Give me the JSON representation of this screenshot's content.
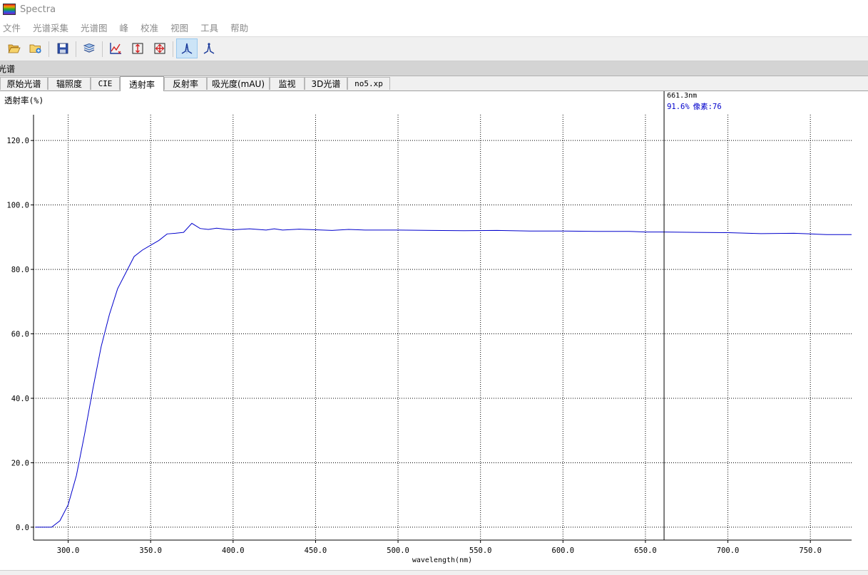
{
  "window": {
    "title": "Spectra"
  },
  "menu": [
    "文件",
    "光谱采集",
    "光谱图",
    "峰",
    "校准",
    "视图",
    "工具",
    "帮助"
  ],
  "toolbar": {
    "buttons": [
      {
        "name": "open-folder-icon"
      },
      {
        "name": "new-folder-icon"
      },
      {
        "name": "save-icon"
      },
      {
        "name": "layers-icon"
      },
      {
        "name": "axis-autoscale-icon"
      },
      {
        "name": "vertical-scale-icon"
      },
      {
        "name": "zoom-fit-icon"
      },
      {
        "name": "peak-marker-icon",
        "active": true
      },
      {
        "name": "peak-label-icon"
      }
    ]
  },
  "panel": {
    "title": "光谱"
  },
  "tabs": {
    "items": [
      "原始光谱",
      "辐照度",
      "CIE",
      "透射率",
      "反射率",
      "吸光度(mAU)",
      "监视",
      "3D光谱",
      "no5.xp"
    ],
    "active_index": 3
  },
  "cursor": {
    "wavelength_label": "661.3nm",
    "readout_value": "91.6%",
    "readout_pixel": "像素:76",
    "x": 661.3
  },
  "colors": {
    "series": "#0000cc",
    "cursor": "#000000",
    "readout": "#0000cc",
    "grid": "#000000"
  },
  "chart_data": {
    "type": "line",
    "ylabel": "透射率(%)",
    "xlabel": "wavelength(nm)",
    "xlim": [
      279,
      775
    ],
    "ylim": [
      -4,
      128
    ],
    "xticks": [
      300,
      350,
      400,
      450,
      500,
      550,
      600,
      650,
      700,
      750
    ],
    "xtick_labels": [
      "300.0",
      "350.0",
      "400.0",
      "450.0",
      "500.0",
      "550.0",
      "600.0",
      "650.0",
      "700.0",
      "750.0"
    ],
    "yticks": [
      0,
      20,
      40,
      60,
      80,
      100,
      120
    ],
    "ytick_labels": [
      "0.0",
      "20.0",
      "40.0",
      "60.0",
      "80.0",
      "100.0",
      "120.0"
    ],
    "grid": true,
    "series": [
      {
        "x": [
          280,
          290,
          295,
          300,
          305,
          310,
          315,
          320,
          325,
          330,
          335,
          340,
          345,
          350,
          355,
          360,
          365,
          370,
          375,
          380,
          385,
          390,
          395,
          400,
          410,
          420,
          425,
          430,
          440,
          450,
          460,
          470,
          480,
          500,
          520,
          540,
          560,
          580,
          600,
          620,
          640,
          650,
          661,
          680,
          700,
          720,
          740,
          750,
          760,
          775
        ],
        "y": [
          0,
          0,
          2,
          7,
          16,
          29,
          43,
          56,
          66,
          74,
          79,
          84,
          86,
          87.5,
          89,
          91,
          91.2,
          91.5,
          94.3,
          92.7,
          92.4,
          92.8,
          92.5,
          92.3,
          92.6,
          92.2,
          92.6,
          92.2,
          92.5,
          92.3,
          92.1,
          92.4,
          92.2,
          92.2,
          92.1,
          92.0,
          92.1,
          91.9,
          91.9,
          91.8,
          91.8,
          91.6,
          91.6,
          91.5,
          91.4,
          91.1,
          91.2,
          91.0,
          90.8,
          90.8
        ]
      }
    ]
  }
}
